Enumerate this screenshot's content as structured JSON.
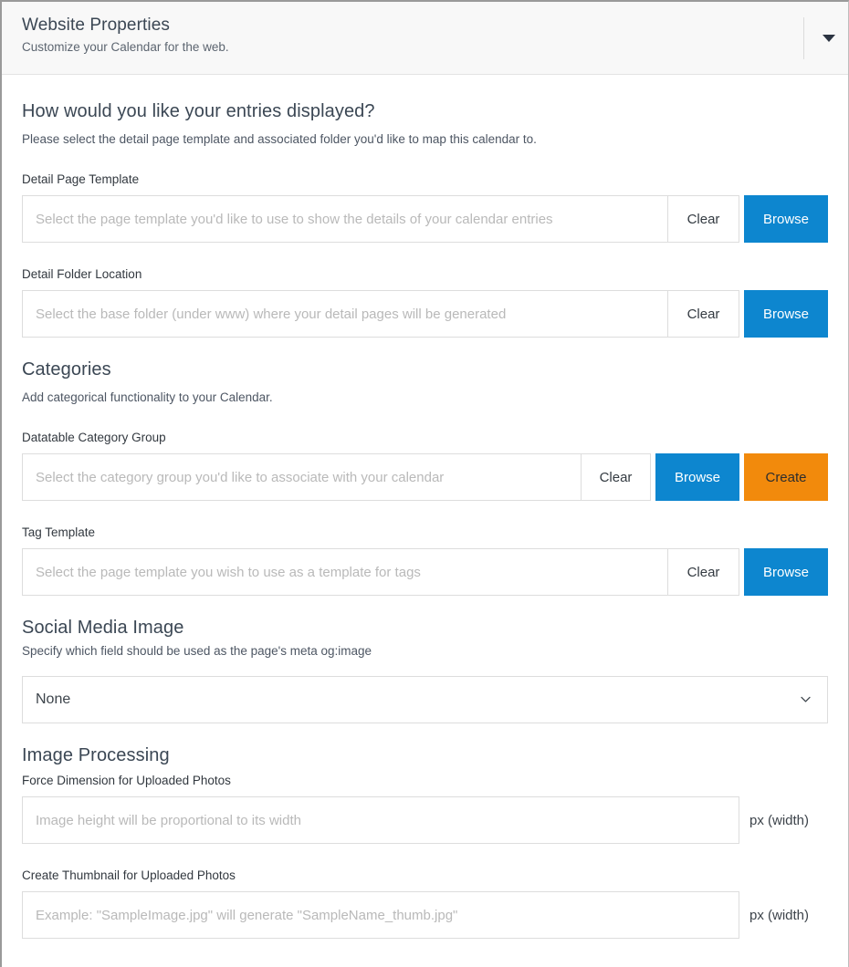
{
  "header": {
    "title": "Website Properties",
    "subtitle": "Customize your Calendar for the web.",
    "caret_icon": "caret-down-icon"
  },
  "entries_section": {
    "heading": "How would you like your entries displayed?",
    "description": "Please select the detail page template and associated folder you'd like to map this calendar to.",
    "detail_page_template": {
      "label": "Detail Page Template",
      "value": "",
      "placeholder": "Select the page template you'd like to use to show the details of your calendar entries",
      "clear_label": "Clear",
      "browse_label": "Browse"
    },
    "detail_folder_location": {
      "label": "Detail Folder Location",
      "value": "",
      "placeholder": "Select the base folder (under www) where your detail pages will be generated",
      "clear_label": "Clear",
      "browse_label": "Browse"
    }
  },
  "categories_section": {
    "heading": "Categories",
    "description": "Add categorical functionality to your Calendar.",
    "datatable_category_group": {
      "label": "Datatable Category Group",
      "value": "",
      "placeholder": "Select the category group you'd like to associate with your calendar",
      "clear_label": "Clear",
      "browse_label": "Browse",
      "create_label": "Create"
    },
    "tag_template": {
      "label": "Tag Template",
      "value": "",
      "placeholder": "Select the page template you wish to use as a template for tags",
      "clear_label": "Clear",
      "browse_label": "Browse"
    }
  },
  "social_media_section": {
    "heading": "Social Media Image",
    "description": "Specify which field should be used as the page's meta og:image",
    "select": {
      "selected": "None",
      "chevron_icon": "chevron-down-icon"
    }
  },
  "image_processing_section": {
    "heading": "Image Processing",
    "force_dimension": {
      "label": "Force Dimension for Uploaded Photos",
      "value": "",
      "placeholder": "Image height will be proportional to its width",
      "unit": "px (width)"
    },
    "create_thumbnail": {
      "label": "Create Thumbnail for Uploaded Photos",
      "value": "",
      "placeholder": "Example: \"SampleImage.jpg\" will generate \"SampleName_thumb.jpg\"",
      "unit": "px (width)"
    }
  },
  "colors": {
    "browse_blue": "#0d86cf",
    "create_orange": "#f28a0c",
    "header_bg": "#f8f8f8",
    "heading_text": "#3b4754",
    "placeholder": "#b9b9b9"
  }
}
